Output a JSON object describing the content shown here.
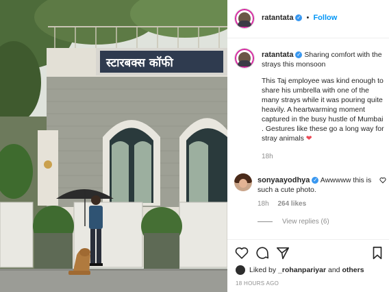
{
  "post": {
    "username": "ratantata",
    "follow_separator": "•",
    "follow_label": "Follow",
    "caption_line1": "Sharing comfort with the strays this monsoon",
    "caption_line2": "This Taj employee was kind enough to share his umbrella with one of the many strays while it was pouring quite heavily. A heartwarming moment captured in the busy hustle of Mumbai . Gestures like these go a long way for stray animals",
    "caption_heart": "❤",
    "caption_time": "18h",
    "photo_sign_text": "स्टारबक्स कॉफी"
  },
  "comment": {
    "username": "sonyaayodhya",
    "text": "Awwwww this is such a cute photo.",
    "time": "18h",
    "likes": "264 likes",
    "view_replies": "View replies (6)"
  },
  "footer": {
    "liked_prefix": "Liked by",
    "liked_user": "_rohanpariyar",
    "liked_and": "and",
    "liked_others": "others",
    "timestamp": "18 HOURS AGO"
  },
  "icons": {
    "verified": "verified-badge-icon",
    "like": "heart-icon",
    "comment": "comment-icon",
    "share": "send-icon",
    "save": "bookmark-icon",
    "comment_like": "heart-outline-icon"
  },
  "colors": {
    "follow": "#0095f6",
    "verified": "#3897f0",
    "secondary_text": "#8e8e8e",
    "caption_heart": "#ed4956"
  }
}
